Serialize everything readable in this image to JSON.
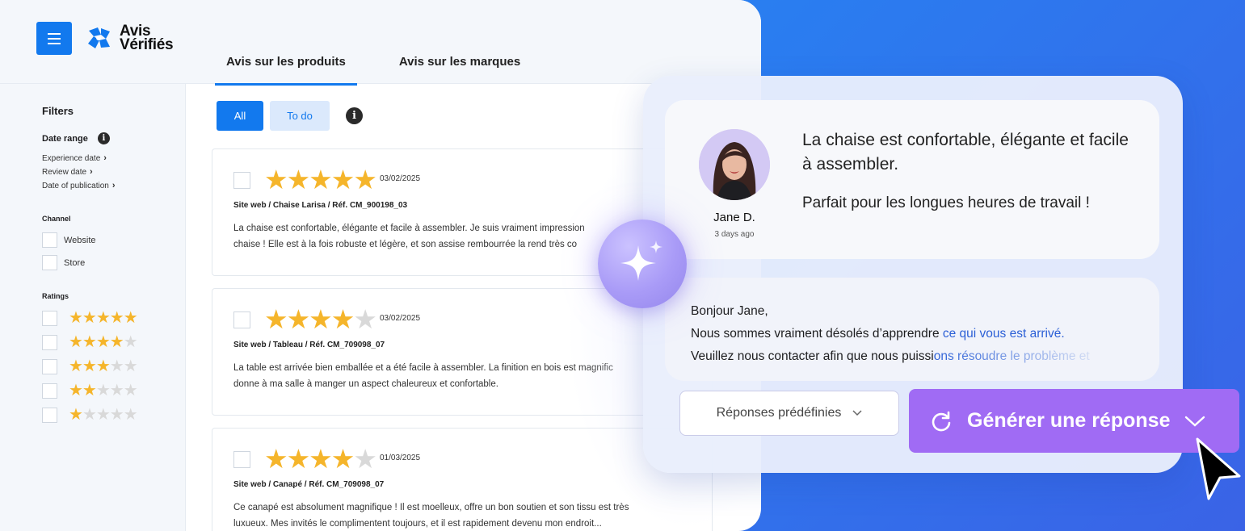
{
  "header": {
    "logo_line1": "Avis",
    "logo_line2": "Vérifiés",
    "tabs": [
      {
        "label": "Avis sur les produits",
        "active": true
      },
      {
        "label": "Avis sur les marques",
        "active": false
      }
    ]
  },
  "sidebar": {
    "title": "Filters",
    "date_range_label": "Date range",
    "date_links": [
      "Experience date",
      "Review date",
      "Date of publication"
    ],
    "channel_label": "Channel",
    "channels": [
      "Website",
      "Store"
    ],
    "ratings_label": "Ratings",
    "ratings": [
      5,
      4,
      3,
      2,
      1
    ]
  },
  "filters": {
    "all_label": "All",
    "todo_label": "To do"
  },
  "reviews": [
    {
      "rating": 5,
      "date": "03/02/2025",
      "meta": "Site web / Chaise Larisa / Réf. CM_900198_03",
      "line1": "La chaise est confortable, élégante et facile à assembler. Je suis vraiment impression",
      "line2": "chaise ! Elle est à la fois robuste et légère, et son assise rembourrée la rend très co"
    },
    {
      "rating": 4,
      "date": "03/02/2025",
      "meta": "Site web / Tableau / Réf. CM_709098_07",
      "line1": "La table est arrivée bien emballée et a été facile à assembler. La finition en bois est magnific",
      "line2": "donne à ma salle à manger un aspect chaleureux et confortable."
    },
    {
      "rating": 4,
      "date": "01/03/2025",
      "meta": "Site web / Canapé / Réf. CM_709098_07",
      "line1": "Ce canapé est absolument magnifique ! Il est moelleux, offre un bon soutien et son tissu est très",
      "line2": "luxueux. Mes invités le complimentent toujours, et il est rapidement devenu mon endroit..."
    }
  ],
  "ai_panel": {
    "author": "Jane D.",
    "ago": "3 days ago",
    "quote1": "La chaise est confortable, élégante et facile à assembler.",
    "quote2": "Parfait pour les longues heures de travail !",
    "reply_greeting": "Bonjour Jane,",
    "reply_l2_a": "Nous sommes vraiment désolés d’apprendre ",
    "reply_l2_b": "ce qui vous est arrivé.",
    "reply_l3_a": "Veuillez nous contacter afin que nous puissi",
    "reply_l3_b": "ons résoudre le problème et",
    "predef_label": "Réponses prédéfinies",
    "generate_label": "Générer une réponse"
  },
  "colors": {
    "brand_blue": "#1279ee",
    "star": "#f5b52b",
    "ai_purple": "#a06bf4"
  }
}
